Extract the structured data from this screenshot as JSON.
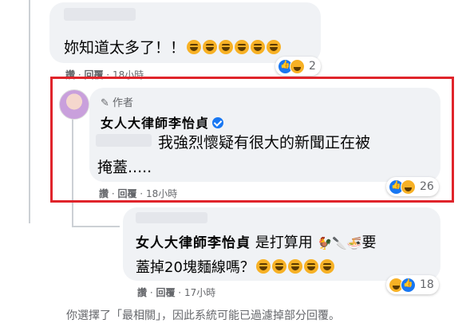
{
  "comment1": {
    "text": "妳知道太多了！！",
    "haha_count_in_text": 6,
    "actions": {
      "like": "讚",
      "reply": "回覆",
      "time": "18小時"
    },
    "reaction_count": "2"
  },
  "comment2": {
    "author_badge": "作者",
    "author_name": "女人大律師李怡貞",
    "text_line1": "我強烈懷疑有很大的新聞正在被",
    "text_line2": "掩蓋.....",
    "actions": {
      "like": "讚",
      "reply": "回覆",
      "time": "18小時"
    },
    "reaction_count": "26"
  },
  "comment3": {
    "mentioned_name": "女人大律師李怡貞",
    "text_part1": "是打算用",
    "text_line2": "蓋掉20塊麵線嗎？",
    "haha_count_in_text": 5,
    "actions": {
      "like": "讚",
      "reply": "回覆",
      "time": "17小時"
    },
    "reaction_count": "18"
  },
  "footer": {
    "note": "你選擇了「最相關」，因此系統可能已過濾掉部分回覆。"
  },
  "colors": {
    "highlight_border": "#e0242b",
    "bubble_bg": "#f0f2f5",
    "meta_text": "#65676b",
    "like_blue": "#1877f2"
  }
}
